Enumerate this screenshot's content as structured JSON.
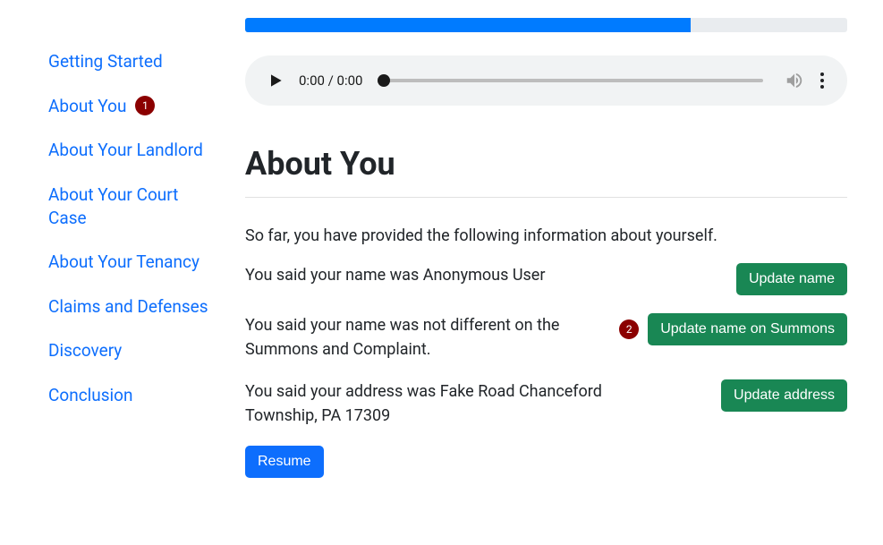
{
  "sidebar": {
    "items": [
      {
        "label": "Getting Started"
      },
      {
        "label": "About You"
      },
      {
        "label": "About Your Landlord"
      },
      {
        "label": "About Your Court Case"
      },
      {
        "label": "About Your Tenancy"
      },
      {
        "label": "Claims and Defenses"
      },
      {
        "label": "Discovery"
      },
      {
        "label": "Conclusion"
      }
    ]
  },
  "annotations": {
    "badge1": "1",
    "badge2": "2"
  },
  "progress": {
    "percent": "74%"
  },
  "audio": {
    "time_display": "0:00 / 0:00"
  },
  "main": {
    "heading": "About You",
    "intro": "So far, you have provided the following information about yourself.",
    "rows": [
      {
        "text": "You said your name was Anonymous User",
        "button": "Update name"
      },
      {
        "text": "You said your name was not different on the Summons and Complaint.",
        "button": "Update name on Summons"
      },
      {
        "text": "You said your address was Fake Road Chanceford Township, PA 17309",
        "button": "Update address"
      }
    ],
    "resume_label": "Resume"
  }
}
